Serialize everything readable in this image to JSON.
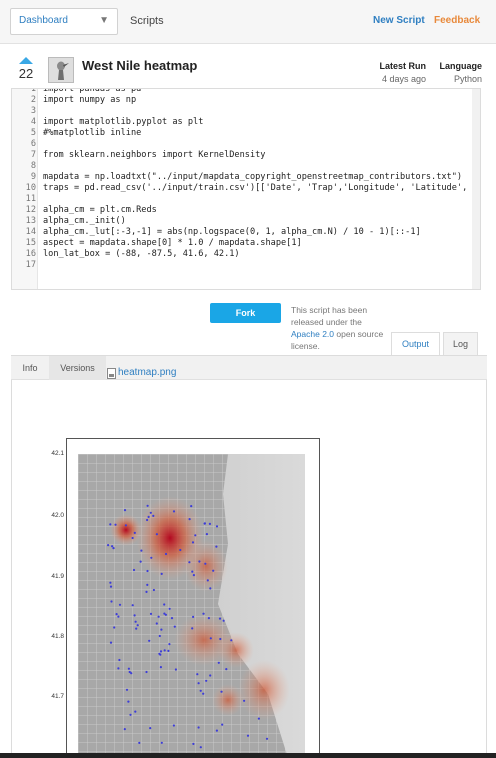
{
  "header": {
    "dashboard_select": "Dashboard",
    "breadcrumb": "Scripts",
    "new_script": "New Script",
    "feedback": "Feedback"
  },
  "script": {
    "votes": "22",
    "title": "West Nile heatmap",
    "latest_run_label": "Latest Run",
    "latest_run_value": "4 days ago",
    "language_label": "Language",
    "language_value": "Python"
  },
  "code_lines": [
    {
      "n": "1",
      "t": "import pandas as pd"
    },
    {
      "n": "2",
      "t": "import numpy as np"
    },
    {
      "n": "3",
      "t": ""
    },
    {
      "n": "4",
      "t": "import matplotlib.pyplot as plt"
    },
    {
      "n": "5",
      "t": "#%matplotlib inline"
    },
    {
      "n": "6",
      "t": ""
    },
    {
      "n": "7",
      "t": "from sklearn.neighbors import KernelDensity"
    },
    {
      "n": "8",
      "t": ""
    },
    {
      "n": "9",
      "t": "mapdata = np.loadtxt(\"../input/mapdata_copyright_openstreetmap_contributors.txt\")"
    },
    {
      "n": "10",
      "t": "traps = pd.read_csv('../input/train.csv')[['Date', 'Trap','Longitude', 'Latitude',"
    },
    {
      "n": "11",
      "t": ""
    },
    {
      "n": "12",
      "t": "alpha_cm = plt.cm.Reds"
    },
    {
      "n": "13",
      "t": "alpha_cm._init()"
    },
    {
      "n": "14",
      "t": "alpha_cm._lut[:-3,-1] = abs(np.logspace(0, 1, alpha_cm.N) / 10 - 1)[::-1]"
    },
    {
      "n": "15",
      "t": "aspect = mapdata.shape[0] * 1.0 / mapdata.shape[1]"
    },
    {
      "n": "16",
      "t": "lon_lat_box = (-88, -87.5, 41.6, 42.1)"
    },
    {
      "n": "17",
      "t": ""
    }
  ],
  "actions": {
    "fork_label": "Fork",
    "license_prefix": "This script has been released under the",
    "license_link": "Apache 2.0",
    "license_suffix": "open source license.",
    "output_tab": "Output",
    "log_tab": "Log"
  },
  "output": {
    "info_tab": "Info",
    "versions_tab": "Versions",
    "file_name": "heatmap.png",
    "y_ticks": [
      "42.1",
      "42.0",
      "41.9",
      "41.8",
      "41.7"
    ]
  },
  "colors": {
    "link_blue": "#2f7fc1",
    "feedback_orange": "#e8893b",
    "fork_blue": "#1aa6e6"
  }
}
